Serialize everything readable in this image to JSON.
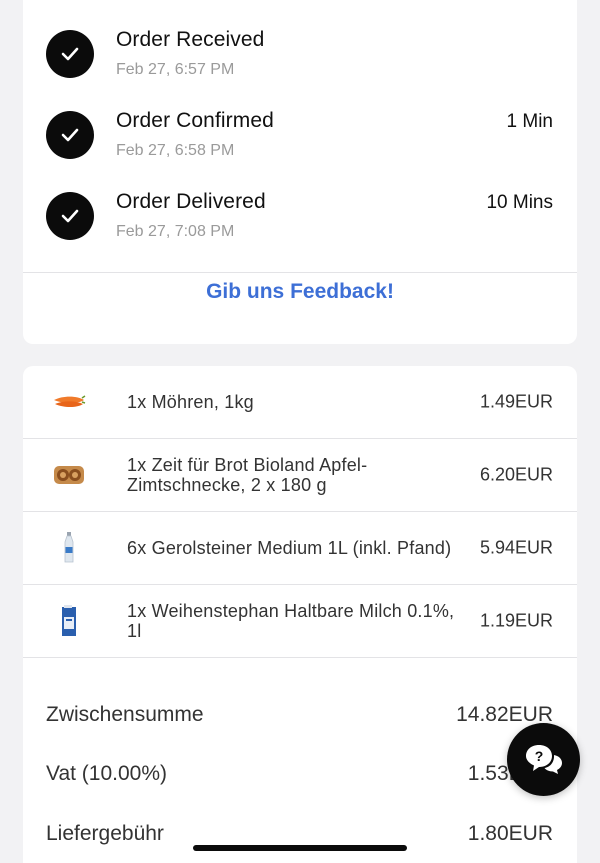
{
  "status": {
    "steps": [
      {
        "title": "Order Received",
        "time": "Feb 27, 6:57 PM",
        "duration": ""
      },
      {
        "title": "Order Confirmed",
        "time": "Feb 27, 6:58 PM",
        "duration": "1 Min"
      },
      {
        "title": "Order Delivered",
        "time": "Feb 27, 7:08 PM",
        "duration": "10 Mins"
      }
    ],
    "feedback_label": "Gib uns Feedback!"
  },
  "items": [
    {
      "name": "1x Möhren, 1kg",
      "price": "1.49EUR",
      "icon": "carrot-icon"
    },
    {
      "name": "1x Zeit für Brot Bioland Apfel-Zimtschnecke, 2 x 180 g",
      "price": "6.20EUR",
      "icon": "pastry-icon"
    },
    {
      "name": "6x Gerolsteiner Medium 1L (inkl. Pfand)",
      "price": "5.94EUR",
      "icon": "water-bottle-icon"
    },
    {
      "name": "1x Weihenstephan Haltbare Milch 0.1%, 1l",
      "price": "1.19EUR",
      "icon": "milk-carton-icon"
    }
  ],
  "summary": {
    "subtotal_label": "Zwischensumme",
    "subtotal_value": "14.82EUR",
    "vat_label": "Vat (10.00%)",
    "vat_value": "1.53EUR",
    "delivery_label": "Liefergebühr",
    "delivery_value": "1.80EUR"
  },
  "colors": {
    "accent": "#3d6fd6",
    "check_bg": "#0b0b0b"
  }
}
